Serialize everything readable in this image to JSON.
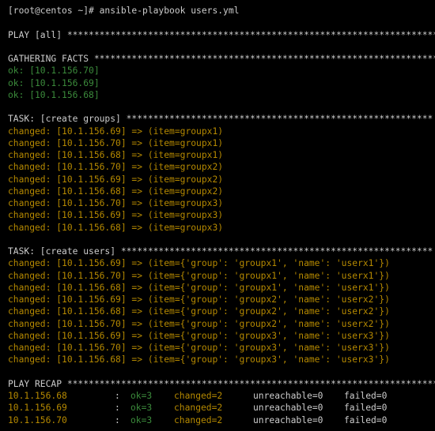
{
  "prompt": "[root@centos ~]# ansible-playbook users.yml",
  "play_header": "PLAY [all] *********************************************************************",
  "gathering_header": "GATHERING FACTS ****************************************************************",
  "gathering_lines": [
    "ok: [10.1.156.70]",
    "ok: [10.1.156.69]",
    "ok: [10.1.156.68]"
  ],
  "task_groups_header": "TASK: [create groups] *********************************************************",
  "task_groups_lines": [
    "changed: [10.1.156.69] => (item=groupx1)",
    "changed: [10.1.156.70] => (item=groupx1)",
    "changed: [10.1.156.68] => (item=groupx1)",
    "changed: [10.1.156.70] => (item=groupx2)",
    "changed: [10.1.156.69] => (item=groupx2)",
    "changed: [10.1.156.68] => (item=groupx2)",
    "changed: [10.1.156.70] => (item=groupx3)",
    "changed: [10.1.156.69] => (item=groupx3)",
    "changed: [10.1.156.68] => (item=groupx3)"
  ],
  "task_users_header": "TASK: [create users] **********************************************************",
  "task_users_lines": [
    "changed: [10.1.156.69] => (item={'group': 'groupx1', 'name': 'userx1'})",
    "changed: [10.1.156.70] => (item={'group': 'groupx1', 'name': 'userx1'})",
    "changed: [10.1.156.68] => (item={'group': 'groupx1', 'name': 'userx1'})",
    "changed: [10.1.156.69] => (item={'group': 'groupx2', 'name': 'userx2'})",
    "changed: [10.1.156.68] => (item={'group': 'groupx2', 'name': 'userx2'})",
    "changed: [10.1.156.70] => (item={'group': 'groupx2', 'name': 'userx2'})",
    "changed: [10.1.156.69] => (item={'group': 'groupx3', 'name': 'userx3'})",
    "changed: [10.1.156.70] => (item={'group': 'groupx3', 'name': 'userx3'})",
    "changed: [10.1.156.68] => (item={'group': 'groupx3', 'name': 'userx3'})"
  ],
  "recap_header": "PLAY RECAP *********************************************************************",
  "recap_rows": [
    {
      "host": "10.1.156.68",
      "sep": ":",
      "ok": "ok=3",
      "changed": "changed=2",
      "unreachable": "unreachable=0",
      "failed": "failed=0"
    },
    {
      "host": "10.1.156.69",
      "sep": ":",
      "ok": "ok=3",
      "changed": "changed=2",
      "unreachable": "unreachable=0",
      "failed": "failed=0"
    },
    {
      "host": "10.1.156.70",
      "sep": ":",
      "ok": "ok=3",
      "changed": "changed=2",
      "unreachable": "unreachable=0",
      "failed": "failed=0"
    }
  ]
}
